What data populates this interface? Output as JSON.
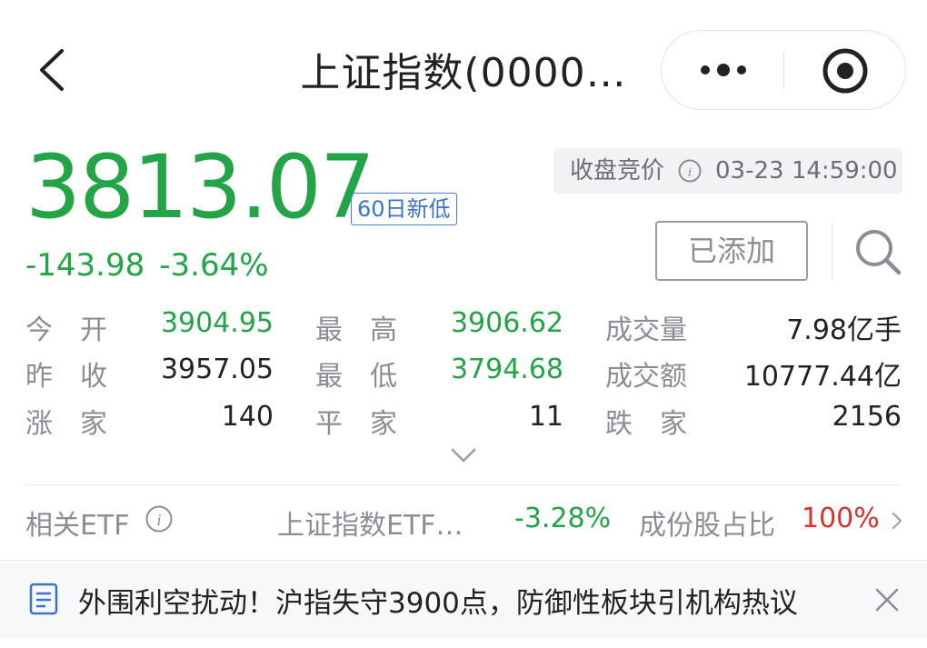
{
  "header": {
    "title": "上证指数(0000…",
    "icons": {
      "back": "back-chevron-icon",
      "more": "more-dots-icon",
      "close_app": "target-circle-icon"
    }
  },
  "quote": {
    "price": "3813.07",
    "badge": "60日新低",
    "change": "-143.98",
    "change_pct": "-3.64%",
    "status_label": "收盘竞价",
    "timestamp": "03-23 14:59:00",
    "added_label": "已添加"
  },
  "stats": {
    "rows": [
      [
        {
          "label": "今开",
          "value": "3904.95",
          "tone": "green"
        },
        {
          "label": "最高",
          "value": "3906.62",
          "tone": "green"
        },
        {
          "label": "成交量",
          "value": "7.98亿手",
          "tone": "dark"
        }
      ],
      [
        {
          "label": "昨收",
          "value": "3957.05",
          "tone": "dark"
        },
        {
          "label": "最低",
          "value": "3794.68",
          "tone": "green"
        },
        {
          "label": "成交额",
          "value": "10777.44亿",
          "tone": "dark"
        }
      ],
      [
        {
          "label": "涨家",
          "value": "140",
          "tone": "dark"
        },
        {
          "label": "平家",
          "value": "11",
          "tone": "dark"
        },
        {
          "label": "跌家",
          "value": "2156",
          "tone": "dark"
        }
      ]
    ]
  },
  "etf": {
    "label": "相关ETF",
    "name": "上证指数ETF…",
    "pct": "-3.28%",
    "share_label": "成份股占比",
    "share_value": "100%"
  },
  "news": {
    "headline": "外围利空扰动！沪指失守3900点，防御性板块引机构热议"
  },
  "colors": {
    "green": "#22a447",
    "red": "#d8302f",
    "blue": "#3b73cc",
    "gray": "#8a8d94"
  }
}
